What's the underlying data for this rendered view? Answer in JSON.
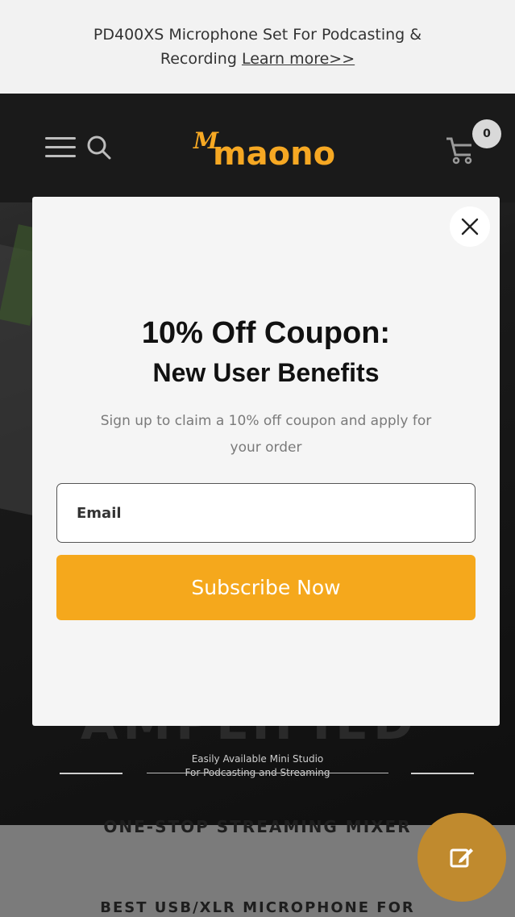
{
  "announcement": {
    "line1": "PD400XS Microphone Set For Podcasting &",
    "line2_prefix": "Recording ",
    "link": "Learn more>>"
  },
  "header": {
    "logo_mark": "M",
    "logo_text": "maono",
    "cart_count": "0",
    "icons": [
      "menu-icon",
      "search-icon",
      "cart-icon"
    ]
  },
  "hero": {
    "big_text": "AMPLIFIED",
    "sub_line1": "Easily Available Mini Studio",
    "sub_line2": "For Podcasting and Streaming"
  },
  "below": {
    "cut_heading": "ONE-STOP STREAMING MIXER",
    "cut_heading2": "BEST USB/XLR MICROPHONE FOR"
  },
  "modal": {
    "title": "10% Off Coupon:",
    "subtitle": "New User Benefits",
    "description": "Sign up to claim a 10% off coupon and apply for your order",
    "email_placeholder": "Email",
    "subscribe_label": "Subscribe Now",
    "close_icon": "close-icon"
  },
  "fab": {
    "icon": "edit-icon"
  },
  "colors": {
    "accent": "#f5a81c",
    "header_bg": "#1a1a1a",
    "modal_bg": "#f5f5f5"
  }
}
